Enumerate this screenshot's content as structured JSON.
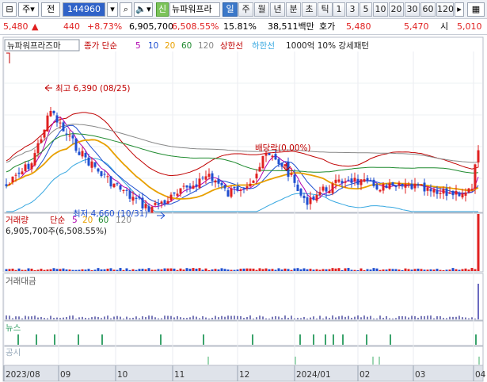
{
  "toolbar": {
    "market": "주",
    "prev_label": "전",
    "code": "144960",
    "stock_name": "뉴파워프라",
    "new_badge": "신",
    "periods": [
      "일",
      "주",
      "월",
      "년",
      "분",
      "초",
      "틱"
    ],
    "active_period": "일",
    "intervals": [
      "1",
      "3",
      "5",
      "10",
      "20",
      "30",
      "60",
      "120"
    ]
  },
  "quote": {
    "price": "5,480",
    "change": "440",
    "change_pct": "+8.73%",
    "volume": "6,905,700",
    "volume_pct": "6,508.55%",
    "turnover": "15.81%",
    "amount": "38,511백만",
    "bid_label": "호가",
    "bid": "5,480",
    "ask": "5,470",
    "open_label": "시",
    "open": "5,010"
  },
  "price_panel": {
    "title": "뉴파워프라즈마",
    "indicator_name": "종가 단순",
    "ma_periods": [
      "5",
      "10",
      "20",
      "60",
      "120"
    ],
    "upper_limit": "상한선",
    "lower_limit": "하한선",
    "pattern_note": "1000억 10% 강세패턴",
    "high_annotation": "최고 6,390 (08/25)",
    "low_annotation": "최저 4,660 (10/31)",
    "event_annotation": "배당락(0.00%)"
  },
  "volume_panel": {
    "title": "거래량",
    "indicator_name": "단순",
    "ma_periods": [
      "5",
      "20",
      "60",
      "120"
    ],
    "value_text": "6,905,700주(6,508.55%)"
  },
  "amount_panel": {
    "title": "거래대금"
  },
  "news_panel": {
    "title": "뉴스"
  },
  "disclosure_panel": {
    "title": "공시"
  },
  "x_axis": {
    "labels": [
      "2023/08",
      "09",
      "10",
      "11",
      "12",
      "2024/01",
      "02",
      "03",
      "04"
    ]
  },
  "colors": {
    "up": "#e02020",
    "down": "#1f4fd0",
    "ma5": "#b000b0",
    "ma10": "#1f4fd0",
    "ma20": "#e8a000",
    "ma60": "#1e8a2e",
    "ma120": "#888888",
    "envelope_upper": "#c00000",
    "envelope_lower": "#36a7e0",
    "news_bar": "#3aa36b",
    "disclosure_bar": "#9ed6b3"
  }
}
